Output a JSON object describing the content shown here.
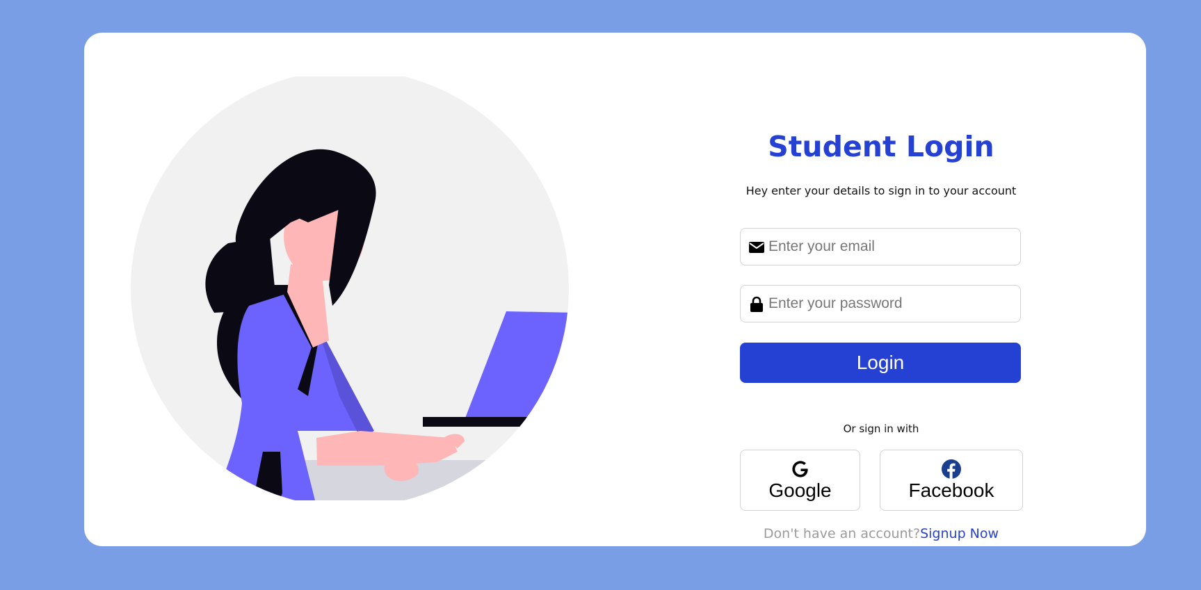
{
  "colors": {
    "background": "#7a9ee6",
    "accent": "#2541d4",
    "card": "#ffffff",
    "illustration_circle": "#f1f1f2",
    "illustration_purple": "#6c63ff",
    "illustration_skin": "#ffb6b6",
    "illustration_hair": "#0b0a14"
  },
  "login": {
    "title": "Student Login",
    "subtitle": "Hey enter your details to sign in to your account",
    "email_placeholder": "Enter your email",
    "email_icon": "envelope-icon",
    "password_placeholder": "Enter your password",
    "password_icon": "lock-icon",
    "login_label": "Login",
    "or_text": "Or sign in with",
    "social": {
      "google_label": "Google",
      "google_icon": "google-icon",
      "facebook_label": "Facebook",
      "facebook_icon": "facebook-icon"
    },
    "signup_prompt": "Don't have an account?",
    "signup_link": "Signup Now"
  }
}
